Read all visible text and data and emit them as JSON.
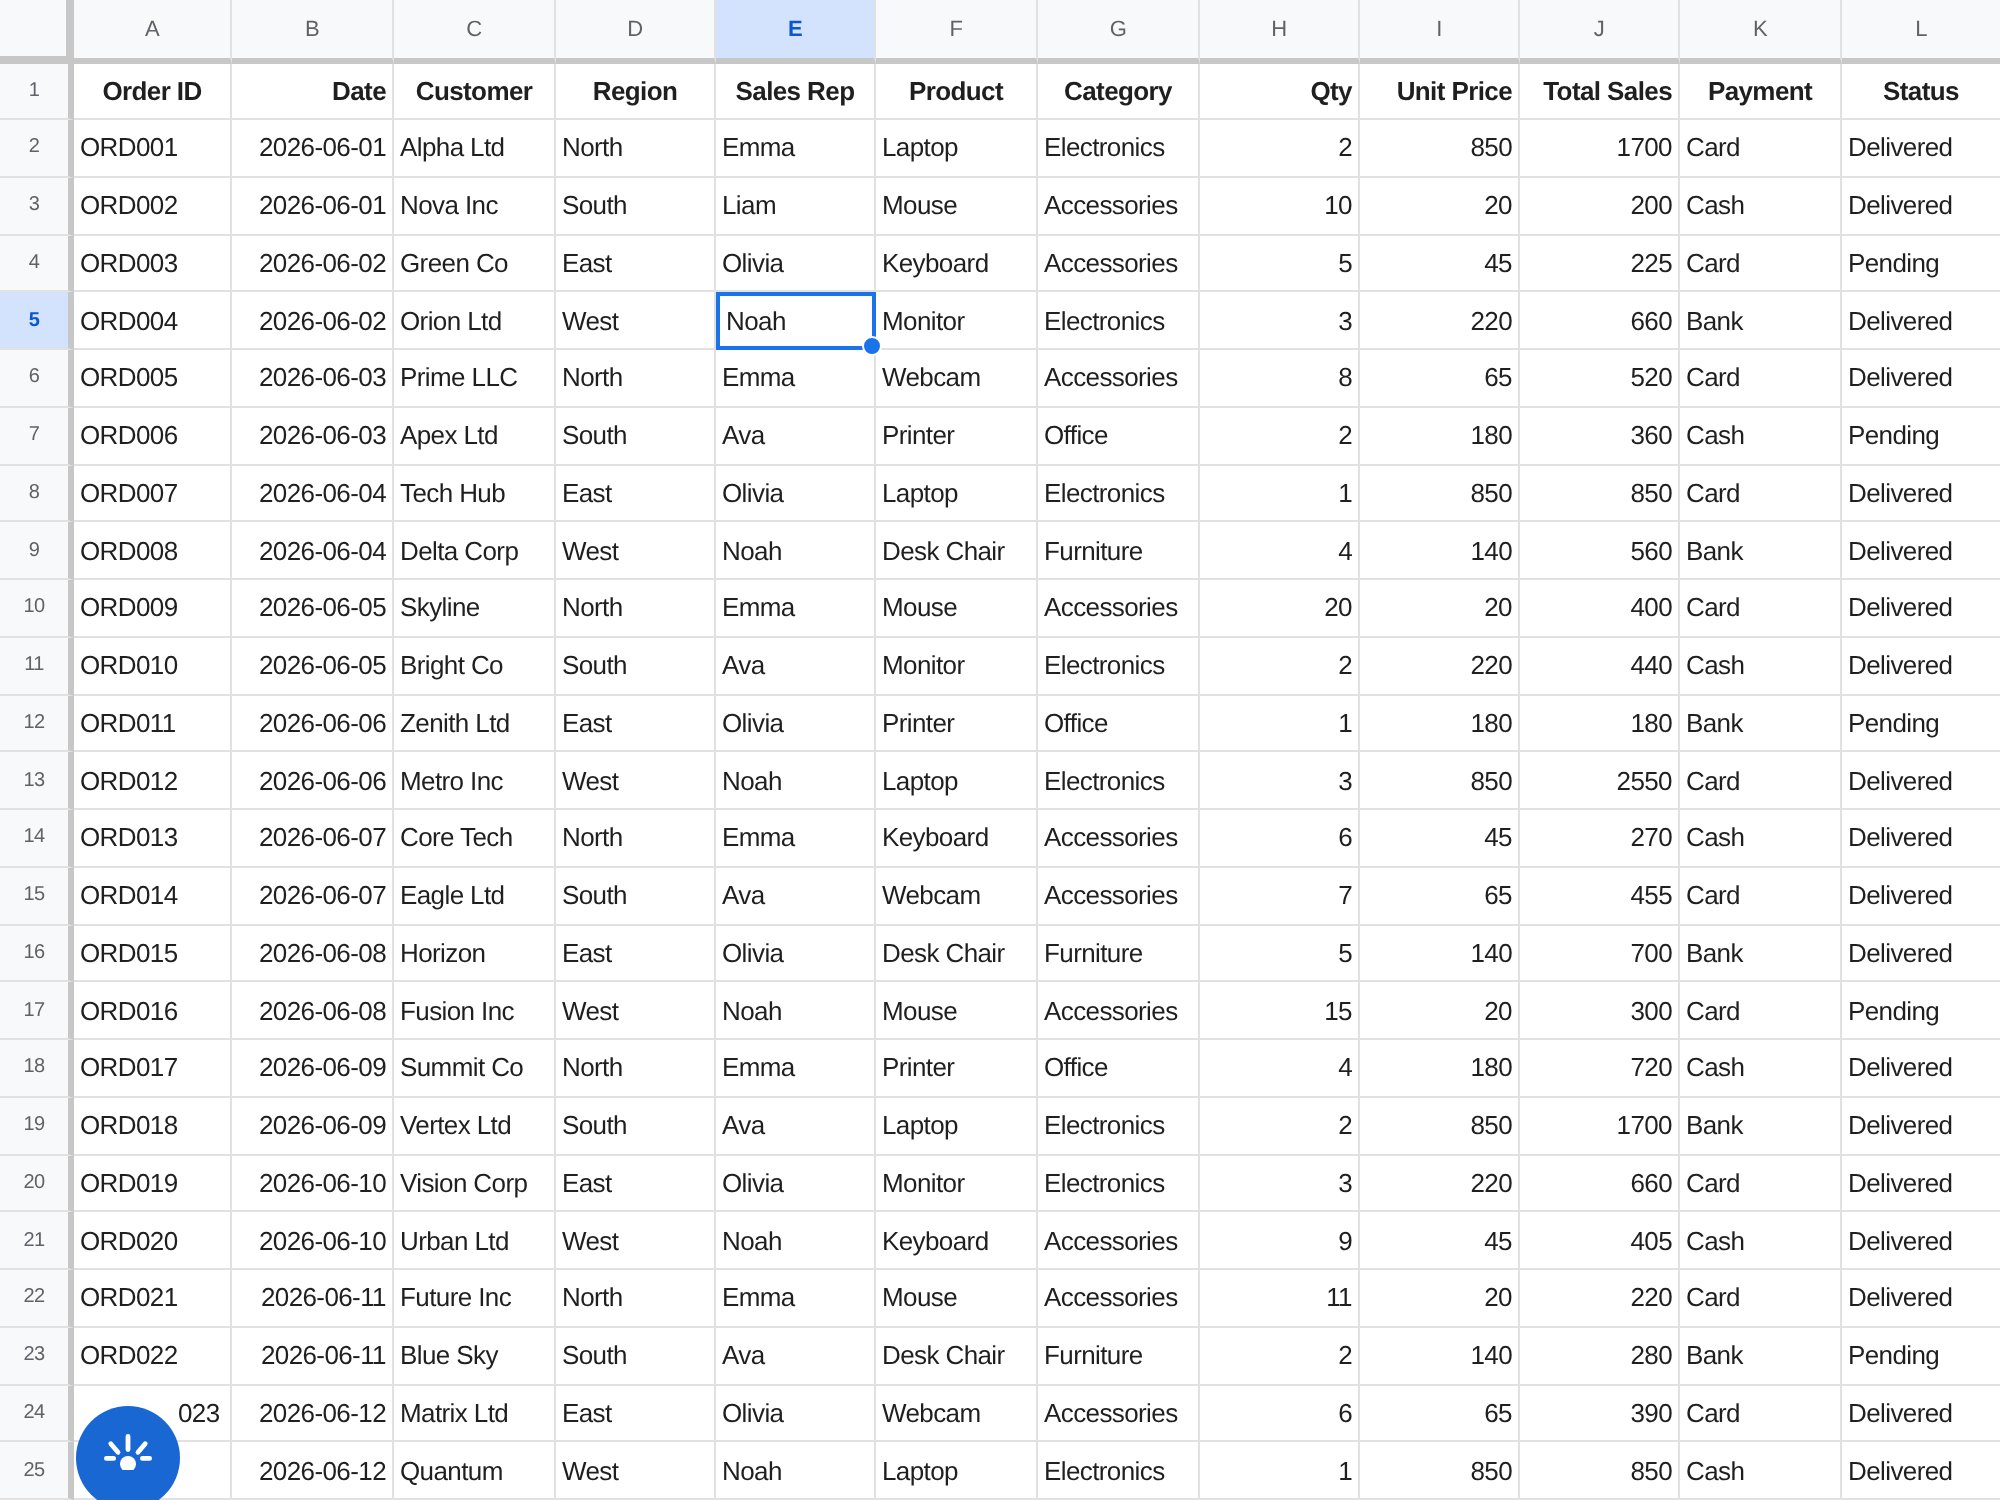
{
  "columns": [
    {
      "letter": "A",
      "title": "Order ID",
      "kind": "text",
      "selected": false
    },
    {
      "letter": "B",
      "title": "Date",
      "kind": "number",
      "selected": false
    },
    {
      "letter": "C",
      "title": "Customer",
      "kind": "text",
      "selected": false
    },
    {
      "letter": "D",
      "title": "Region",
      "kind": "text",
      "selected": false
    },
    {
      "letter": "E",
      "title": "Sales Rep",
      "kind": "text",
      "selected": true
    },
    {
      "letter": "F",
      "title": "Product",
      "kind": "text",
      "selected": false
    },
    {
      "letter": "G",
      "title": "Category",
      "kind": "text",
      "selected": false
    },
    {
      "letter": "H",
      "title": "Qty",
      "kind": "number",
      "selected": false
    },
    {
      "letter": "I",
      "title": "Unit Price",
      "kind": "number",
      "selected": false
    },
    {
      "letter": "J",
      "title": "Total Sales",
      "kind": "number",
      "selected": false
    },
    {
      "letter": "K",
      "title": "Payment",
      "kind": "text",
      "selected": false
    },
    {
      "letter": "L",
      "title": "Status",
      "kind": "text",
      "selected": false
    }
  ],
  "header_row_number": "1",
  "rows": [
    {
      "number": "2",
      "selected": false,
      "cells": [
        "ORD001",
        "2026-06-01",
        "Alpha Ltd",
        "North",
        "Emma",
        "Laptop",
        "Electronics",
        "2",
        "850",
        "1700",
        "Card",
        "Delivered"
      ]
    },
    {
      "number": "3",
      "selected": false,
      "cells": [
        "ORD002",
        "2026-06-01",
        "Nova Inc",
        "South",
        "Liam",
        "Mouse",
        "Accessories",
        "10",
        "20",
        "200",
        "Cash",
        "Delivered"
      ]
    },
    {
      "number": "4",
      "selected": false,
      "cells": [
        "ORD003",
        "2026-06-02",
        "Green Co",
        "East",
        "Olivia",
        "Keyboard",
        "Accessories",
        "5",
        "45",
        "225",
        "Card",
        "Pending"
      ]
    },
    {
      "number": "5",
      "selected": true,
      "cells": [
        "ORD004",
        "2026-06-02",
        "Orion Ltd",
        "West",
        "Noah",
        "Monitor",
        "Electronics",
        "3",
        "220",
        "660",
        "Bank",
        "Delivered"
      ]
    },
    {
      "number": "6",
      "selected": false,
      "cells": [
        "ORD005",
        "2026-06-03",
        "Prime LLC",
        "North",
        "Emma",
        "Webcam",
        "Accessories",
        "8",
        "65",
        "520",
        "Card",
        "Delivered"
      ]
    },
    {
      "number": "7",
      "selected": false,
      "cells": [
        "ORD006",
        "2026-06-03",
        "Apex Ltd",
        "South",
        "Ava",
        "Printer",
        "Office",
        "2",
        "180",
        "360",
        "Cash",
        "Pending"
      ]
    },
    {
      "number": "8",
      "selected": false,
      "cells": [
        "ORD007",
        "2026-06-04",
        "Tech Hub",
        "East",
        "Olivia",
        "Laptop",
        "Electronics",
        "1",
        "850",
        "850",
        "Card",
        "Delivered"
      ]
    },
    {
      "number": "9",
      "selected": false,
      "cells": [
        "ORD008",
        "2026-06-04",
        "Delta Corp",
        "West",
        "Noah",
        "Desk Chair",
        "Furniture",
        "4",
        "140",
        "560",
        "Bank",
        "Delivered"
      ]
    },
    {
      "number": "10",
      "selected": false,
      "cells": [
        "ORD009",
        "2026-06-05",
        "Skyline",
        "North",
        "Emma",
        "Mouse",
        "Accessories",
        "20",
        "20",
        "400",
        "Card",
        "Delivered"
      ]
    },
    {
      "number": "11",
      "selected": false,
      "cells": [
        "ORD010",
        "2026-06-05",
        "Bright Co",
        "South",
        "Ava",
        "Monitor",
        "Electronics",
        "2",
        "220",
        "440",
        "Cash",
        "Delivered"
      ]
    },
    {
      "number": "12",
      "selected": false,
      "cells": [
        "ORD011",
        "2026-06-06",
        "Zenith Ltd",
        "East",
        "Olivia",
        "Printer",
        "Office",
        "1",
        "180",
        "180",
        "Bank",
        "Pending"
      ]
    },
    {
      "number": "13",
      "selected": false,
      "cells": [
        "ORD012",
        "2026-06-06",
        "Metro Inc",
        "West",
        "Noah",
        "Laptop",
        "Electronics",
        "3",
        "850",
        "2550",
        "Card",
        "Delivered"
      ]
    },
    {
      "number": "14",
      "selected": false,
      "cells": [
        "ORD013",
        "2026-06-07",
        "Core Tech",
        "North",
        "Emma",
        "Keyboard",
        "Accessories",
        "6",
        "45",
        "270",
        "Cash",
        "Delivered"
      ]
    },
    {
      "number": "15",
      "selected": false,
      "cells": [
        "ORD014",
        "2026-06-07",
        "Eagle Ltd",
        "South",
        "Ava",
        "Webcam",
        "Accessories",
        "7",
        "65",
        "455",
        "Card",
        "Delivered"
      ]
    },
    {
      "number": "16",
      "selected": false,
      "cells": [
        "ORD015",
        "2026-06-08",
        "Horizon",
        "East",
        "Olivia",
        "Desk Chair",
        "Furniture",
        "5",
        "140",
        "700",
        "Bank",
        "Delivered"
      ]
    },
    {
      "number": "17",
      "selected": false,
      "cells": [
        "ORD016",
        "2026-06-08",
        "Fusion Inc",
        "West",
        "Noah",
        "Mouse",
        "Accessories",
        "15",
        "20",
        "300",
        "Card",
        "Pending"
      ]
    },
    {
      "number": "18",
      "selected": false,
      "cells": [
        "ORD017",
        "2026-06-09",
        "Summit Co",
        "North",
        "Emma",
        "Printer",
        "Office",
        "4",
        "180",
        "720",
        "Cash",
        "Delivered"
      ]
    },
    {
      "number": "19",
      "selected": false,
      "cells": [
        "ORD018",
        "2026-06-09",
        "Vertex Ltd",
        "South",
        "Ava",
        "Laptop",
        "Electronics",
        "2",
        "850",
        "1700",
        "Bank",
        "Delivered"
      ]
    },
    {
      "number": "20",
      "selected": false,
      "cells": [
        "ORD019",
        "2026-06-10",
        "Vision Corp",
        "East",
        "Olivia",
        "Monitor",
        "Electronics",
        "3",
        "220",
        "660",
        "Card",
        "Delivered"
      ]
    },
    {
      "number": "21",
      "selected": false,
      "cells": [
        "ORD020",
        "2026-06-10",
        "Urban Ltd",
        "West",
        "Noah",
        "Keyboard",
        "Accessories",
        "9",
        "45",
        "405",
        "Cash",
        "Delivered"
      ]
    },
    {
      "number": "22",
      "selected": false,
      "cells": [
        "ORD021",
        "2026-06-11",
        "Future Inc",
        "North",
        "Emma",
        "Mouse",
        "Accessories",
        "11",
        "20",
        "220",
        "Card",
        "Delivered"
      ]
    },
    {
      "number": "23",
      "selected": false,
      "cells": [
        "ORD022",
        "2026-06-11",
        "Blue Sky",
        "South",
        "Ava",
        "Desk Chair",
        "Furniture",
        "2",
        "140",
        "280",
        "Bank",
        "Pending"
      ]
    },
    {
      "number": "24",
      "selected": false,
      "cells": [
        {
          "text": "023",
          "kind": "clipped"
        },
        "2026-06-12",
        "Matrix Ltd",
        "East",
        "Olivia",
        "Webcam",
        "Accessories",
        "6",
        "65",
        "390",
        "Card",
        "Delivered"
      ]
    },
    {
      "number": "25",
      "selected": false,
      "cells": [
        {
          "kind": "covered"
        },
        "2026-06-12",
        "Quantum",
        "West",
        "Noah",
        "Laptop",
        "Electronics",
        "1",
        "850",
        "850",
        "Cash",
        "Delivered"
      ]
    }
  ],
  "floating_button": {
    "kind": "assistant"
  }
}
